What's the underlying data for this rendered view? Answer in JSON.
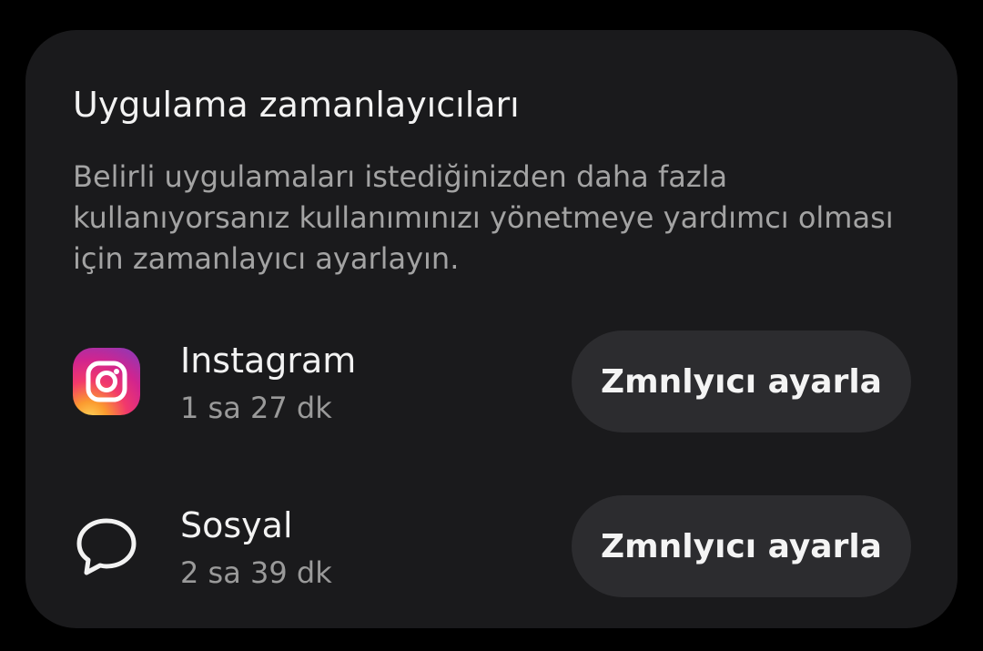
{
  "card": {
    "title": "Uygulama zamanlayıcıları",
    "description": "Belirli uygulamaları istediğinizden daha fazla kullanıyorsanız kullanımınızı yönetmeye yardımcı olması için zamanlayıcı ayarlayın."
  },
  "apps": [
    {
      "name": "Instagram",
      "usage": "1 sa 27 dk",
      "icon": "instagram-icon",
      "button_label": "Zmnlyıcı ayarla"
    },
    {
      "name": "Sosyal",
      "usage": "2 sa 39 dk",
      "icon": "chat-bubble-icon",
      "button_label": "Zmnlyıcı ayarla"
    }
  ],
  "colors": {
    "background": "#000000",
    "card": "#1a1a1c",
    "button": "#2c2c2f",
    "primary_text": "#f2f2f2",
    "secondary_text": "#a3a3a3"
  }
}
